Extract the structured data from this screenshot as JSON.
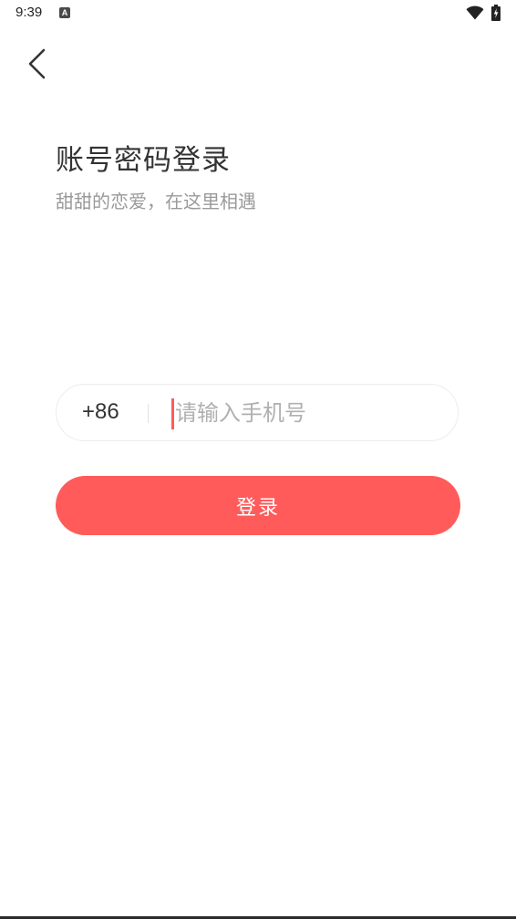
{
  "status_bar": {
    "time": "9:39",
    "notification_icon": "a-icon",
    "wifi_icon": "wifi-icon",
    "battery_icon": "battery-charging-icon"
  },
  "header": {
    "back_icon": "chevron-left-icon"
  },
  "login": {
    "title": "账号密码登录",
    "subtitle": "甜甜的恋爱，在这里相遇",
    "country_code": "+86",
    "phone_placeholder": "请输入手机号",
    "phone_value": "",
    "submit_label": "登录"
  },
  "colors": {
    "accent": "#ff5b5b",
    "title_text": "#333333",
    "subtitle_text": "#9a9a9a",
    "placeholder_text": "#b0b0b0",
    "field_border": "#ececec"
  }
}
